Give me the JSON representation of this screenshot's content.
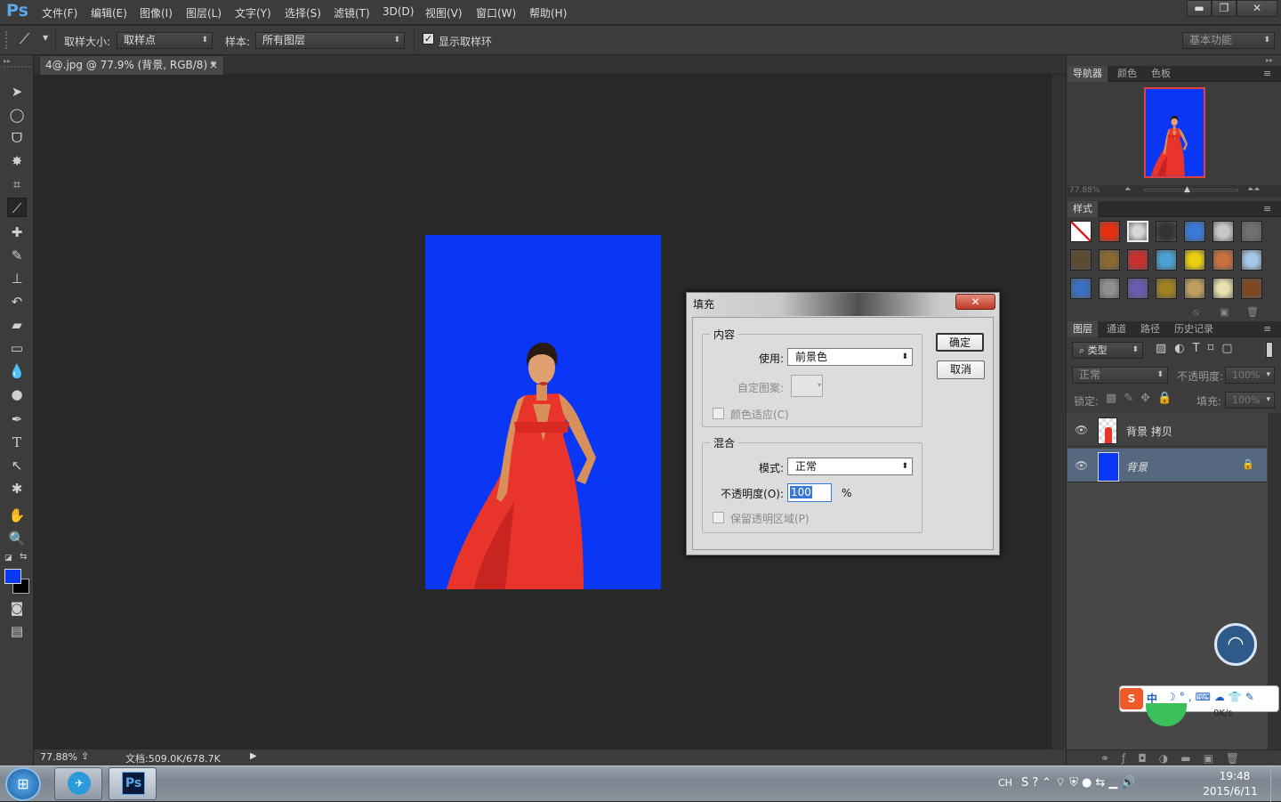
{
  "app": {
    "logo": "Ps"
  },
  "menu": [
    "文件(F)",
    "编辑(E)",
    "图像(I)",
    "图层(L)",
    "文字(Y)",
    "选择(S)",
    "滤镜(T)",
    "3D(D)",
    "视图(V)",
    "窗口(W)",
    "帮助(H)"
  ],
  "window_controls": {
    "minimize": "▬",
    "restore": "❐",
    "close": "✕"
  },
  "options": {
    "sample_size_label": "取样大小:",
    "sample_size_value": "取样点",
    "sample_label": "样本:",
    "sample_value": "所有图层",
    "show_ring_label": "显示取样环",
    "show_ring_checked": true,
    "workspace": "基本功能"
  },
  "document": {
    "tab_title": "4@.jpg @ 77.9% (背景, RGB/8) *",
    "tab_close": "×",
    "bg_color": "#0a37f5",
    "dress_color": "#e8342a"
  },
  "status": {
    "zoom": "77.88%",
    "doc_info": "文档:509.0K/678.7K"
  },
  "colors": {
    "foreground": "#0a37f5",
    "background": "#000000"
  },
  "dialog": {
    "title": "填充",
    "close": "✕",
    "content_group": "内容",
    "use_label": "使用:",
    "use_value": "前景色",
    "custom_pattern_label": "自定图案:",
    "color_adapt_label": "颜色适应(C)",
    "blend_group": "混合",
    "mode_label": "模式:",
    "mode_value": "正常",
    "opacity_label": "不透明度(O):",
    "opacity_value": "100",
    "opacity_unit": "%",
    "preserve_label": "保留透明区域(P)",
    "ok": "确定",
    "cancel": "取消"
  },
  "panels": {
    "nav_tabs": [
      "导航器",
      "颜色",
      "色板"
    ],
    "nav_zoom": "77.88%",
    "styles_tab": "样式",
    "style_swatches": [
      "#ffffff",
      "#e83010",
      "#d8d8d8",
      "#333333",
      "#3a7ad8",
      "#c8c8c8",
      "#707070",
      "#5a4a30",
      "#8a6a30",
      "#c83030",
      "#4aa0d0",
      "#e8d010",
      "#c87040",
      "#a8c8e8",
      "#3a70c0",
      "#909090",
      "#6a5ab0",
      "#a08020",
      "#c0a060",
      "#e8e0b0",
      "#804820"
    ],
    "layer_tabs": [
      "图层",
      "通道",
      "路径",
      "历史记录"
    ],
    "kind_label": "类型",
    "blend_mode": "正常",
    "opacity_label": "不透明度:",
    "opacity_value": "100%",
    "lock_label": "锁定:",
    "fill_label": "填充:",
    "fill_value": "100%",
    "layers": [
      {
        "name": "背景 拷贝",
        "selected": false
      },
      {
        "name": "背景",
        "selected": true
      }
    ]
  },
  "overlay": {
    "net_speed": "0K/s",
    "ime": "中"
  },
  "taskbar": {
    "time": "19:48",
    "date": "2015/6/11",
    "lang": "CH"
  }
}
